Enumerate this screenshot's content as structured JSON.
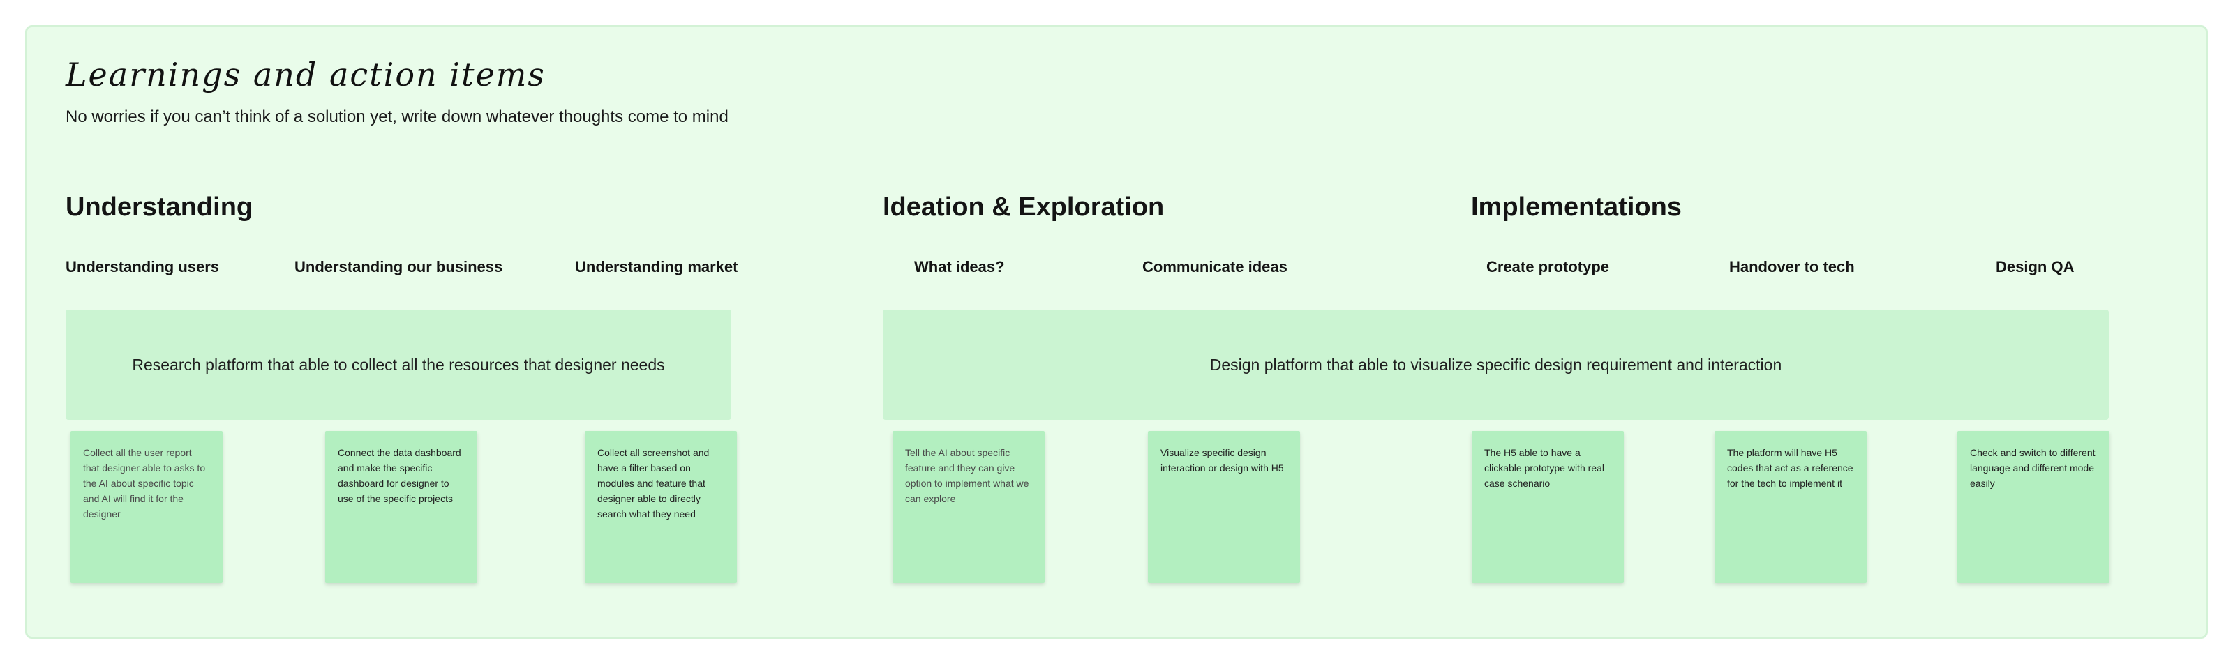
{
  "board": {
    "title": "Learnings and action items",
    "subtitle": "No worries if you can’t think of a solution yet, write down whatever thoughts come to mind"
  },
  "sections": [
    {
      "title": "Understanding",
      "columns": [
        "Understanding users",
        "Understanding our business",
        "Understanding market"
      ],
      "banner": "Research platform that able to collect all the resources that designer needs",
      "stickies": [
        "Collect all the user report that designer able to asks to the AI about specific topic and AI will find it for the designer",
        "Connect the data dashboard and make the specific dashboard for designer to use of the specific projects",
        "Collect all screenshot and have a filter based on modules and feature that designer able to directly search what they need"
      ]
    },
    {
      "title": "Ideation & Exploration",
      "columns": [
        "What ideas?",
        "Communicate ideas"
      ],
      "stickies": [
        "Tell the AI about specific feature and they can give option to implement what we can explore",
        "Visualize specific design interaction or design with H5"
      ]
    },
    {
      "title": "Implementations",
      "columns": [
        "Create prototype",
        "Handover to tech",
        "Design QA"
      ],
      "stickies": [
        "The H5 able to have a clickable prototype with real case schenario",
        "The platform will have H5 codes that act as a reference for the tech to implement it",
        "Check and switch to different language and different mode easily"
      ]
    }
  ],
  "design_banner": "Design platform that able to visualize specific design requirement and interaction",
  "colors": {
    "board_background": "#e9fcea",
    "board_border": "#d3f2d6",
    "banner": "#cbf4d2",
    "sticky": "#b3efc0"
  }
}
